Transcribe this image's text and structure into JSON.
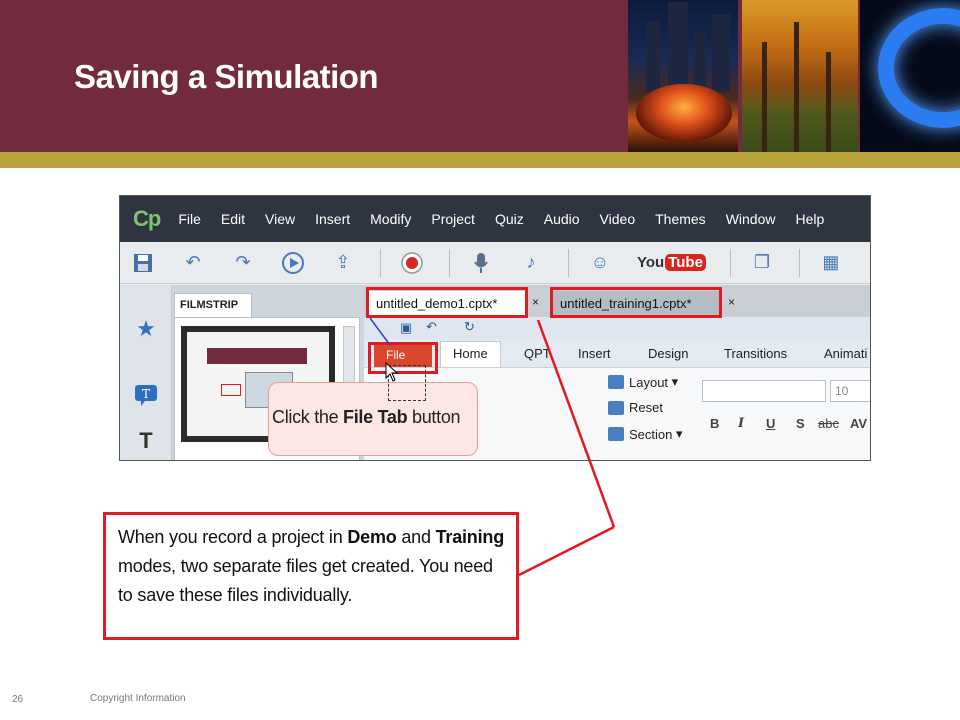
{
  "slide": {
    "title": "Saving a Simulation",
    "page_number": "26",
    "copyright": "Copyright Information"
  },
  "app": {
    "logo": "Cp",
    "menu": [
      "File",
      "Edit",
      "View",
      "Insert",
      "Modify",
      "Project",
      "Quiz",
      "Audio",
      "Video",
      "Themes",
      "Window",
      "Help"
    ],
    "toolbar_icons": [
      "save-icon",
      "undo-icon",
      "redo-icon",
      "play-icon",
      "publish-icon",
      "record-icon",
      "microphone-icon",
      "music-note-icon",
      "user-icon",
      "youtube-logo",
      "windows-icon",
      "table-icon"
    ],
    "youtube": {
      "you": "You",
      "tube": "Tube"
    },
    "filmstrip_label": "FILMSTRIP",
    "doc_tabs": [
      {
        "label": "untitled_demo1.cptx*",
        "close": "×"
      },
      {
        "label": "untitled_training1.cptx*",
        "close": "×"
      }
    ],
    "ribbon": {
      "file_label": "File",
      "tabs": [
        "Home",
        "QPT",
        "Insert",
        "Design",
        "Transitions",
        "Animati"
      ],
      "buttons": [
        "Layout",
        "Reset",
        "Section"
      ],
      "font_size": "10",
      "format_buttons": [
        "B",
        "I",
        "U",
        "S",
        "abc",
        "AV"
      ]
    },
    "callout": {
      "prefix": "Click the ",
      "bold": "File Tab",
      "suffix": " button"
    }
  },
  "description": {
    "part1": "When you record a project in ",
    "demo": "Demo",
    "part2": " and ",
    "training": "Training",
    "part3": " modes, two separate files get created. You need to save these files individually."
  },
  "colors": {
    "header": "#722b3c",
    "gold": "#b8a33b",
    "highlight": "#e01a22"
  }
}
